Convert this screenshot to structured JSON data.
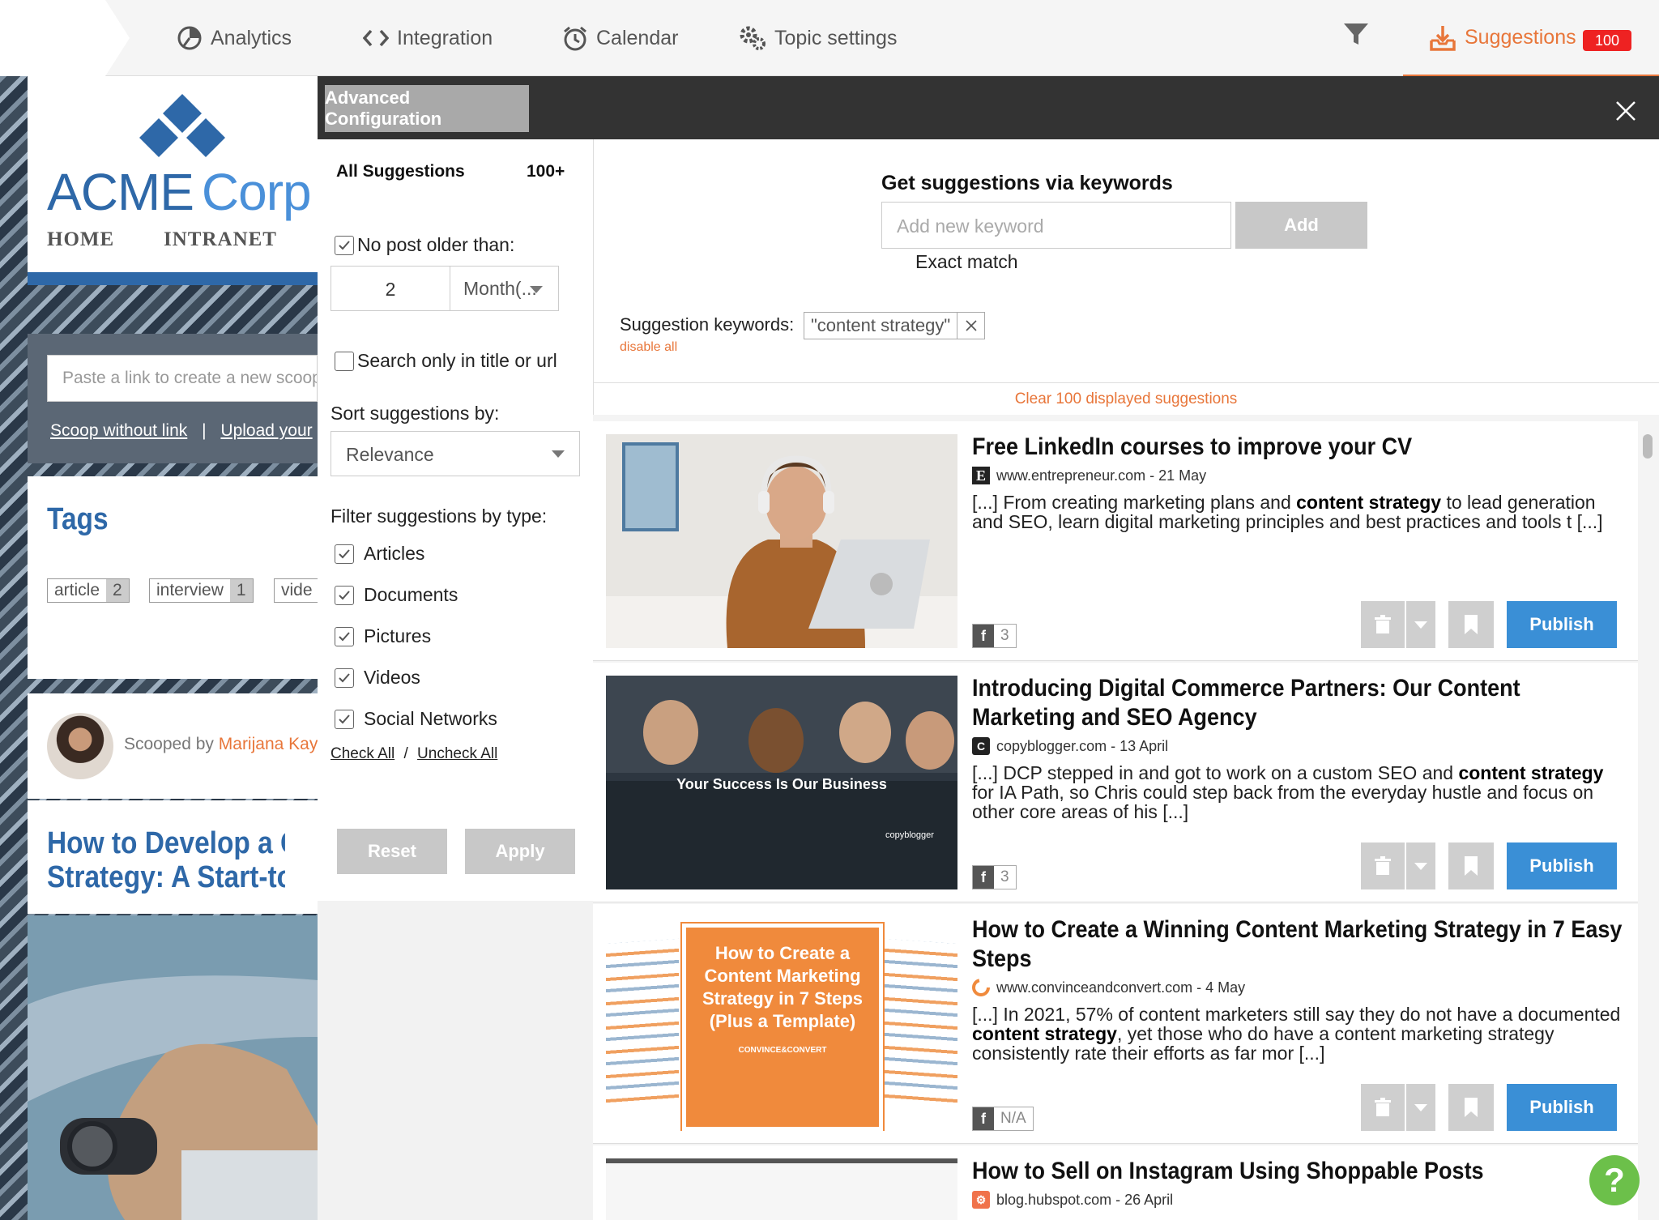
{
  "topnav": {
    "analytics": "Analytics",
    "integration": "Integration",
    "calendar": "Calendar",
    "topic_settings": "Topic settings",
    "suggestions": "Suggestions",
    "suggestions_count": "100"
  },
  "background": {
    "logo_acme": "ACME",
    "logo_corp": "Corp",
    "logo_home": "HOME",
    "logo_intranet": "INTRANET",
    "paste_placeholder": "Paste a link to create a new scoop",
    "scoop_without_link": "Scoop without link",
    "separator": "|",
    "upload": "Upload your",
    "tags_title": "Tags",
    "tags": [
      {
        "label": "article",
        "count": "2"
      },
      {
        "label": "interview",
        "count": "1"
      },
      {
        "label": "vide",
        "count": ""
      }
    ],
    "scooped_by": "Scooped by",
    "scooped_name": "Marijana Kay",
    "article_title_1": "How to Develop a Co",
    "article_title_2": "Strategy: A Start-to-F"
  },
  "panel": {
    "advanced_config": "Advanced Configuration",
    "all_suggestions": "All Suggestions",
    "all_count": "100+",
    "no_post_older": "No post older than:",
    "age_value": "2",
    "age_unit": "Month(...",
    "search_title_url": "Search only in title or url",
    "sort_label": "Sort suggestions by:",
    "sort_value": "Relevance",
    "filter_label": "Filter suggestions by type:",
    "types": [
      "Articles",
      "Documents",
      "Pictures",
      "Videos",
      "Social Networks"
    ],
    "check_all": "Check All",
    "slash": "/",
    "uncheck_all": "Uncheck All",
    "reset": "Reset",
    "apply": "Apply"
  },
  "keywords": {
    "title": "Get suggestions via keywords",
    "placeholder": "Add new keyword",
    "add": "Add",
    "exact_match": "Exact match",
    "suggestion_keywords": "Suggestion keywords:",
    "chip": "\"content strategy\"",
    "disable_all": "disable all",
    "clear": "Clear 100 displayed suggestions"
  },
  "items": [
    {
      "title": "Free LinkedIn courses to improve your CV",
      "source": "www.entrepreneur.com - 21 May",
      "excerpt_pre": "[...] From creating marketing plans and ",
      "excerpt_bold": "content strategy",
      "excerpt_post": " to lead generation and SEO, learn digital marketing principles and best practices and tools t [...]",
      "fb_count": "3",
      "publish": "Publish",
      "source_icon": "entrepreneur-icon"
    },
    {
      "title": "Introducing Digital Commerce Partners: Our Content Marketing and SEO Agency",
      "source": "copyblogger.com - 13 April",
      "excerpt_pre": "[...] DCP stepped in and got to work on a custom SEO and ",
      "excerpt_bold": "content strategy",
      "excerpt_post": " for IA Path, so Chris could step back from the everyday hustle and focus on other core areas of his [...]",
      "fb_count": "3",
      "publish": "Publish",
      "thumb_text": "Your Success Is Our Business",
      "thumb_small": "copyblogger",
      "source_icon": "copyblogger-icon"
    },
    {
      "title": "How to Create a Winning Content Marketing Strategy in 7 Easy Steps",
      "source": "www.convinceandconvert.com - 4 May",
      "excerpt_pre": "[...] In 2021, 57% of content marketers still say they do not have a documented ",
      "excerpt_bold": "content strategy",
      "excerpt_post": ", yet those who do have a content marketing strategy consistently rate their efforts as far mor [...]",
      "fb_count": "N/A",
      "publish": "Publish",
      "thumb_text": "How to Create a Content Marketing Strategy in 7 Steps (Plus a Template)",
      "thumb_small": "CONVINCE&CONVERT",
      "source_icon": "convince-icon"
    },
    {
      "title": "How to Sell on Instagram Using Shoppable Posts",
      "source": "blog.hubspot.com - 26 April",
      "source_icon": "hubspot-icon"
    }
  ],
  "help": "?"
}
